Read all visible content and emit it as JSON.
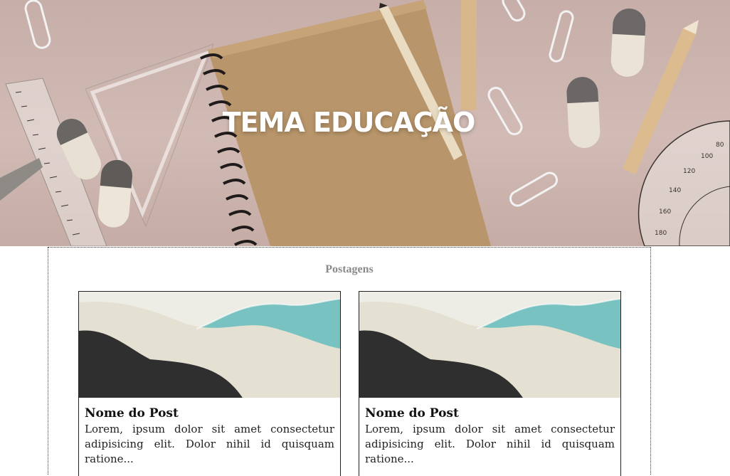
{
  "hero": {
    "title": "TEMA EDUCAÇÃO",
    "image": "school-supplies-background"
  },
  "posts_section": {
    "title": "Postagens",
    "cards": [
      {
        "title": "Nome do Post",
        "text": "Lorem, ipsum dolor sit amet consectetur adipisicing elit. Dolor nihil id quisquam ratione...",
        "image": "abstract-waves-thumbnail"
      },
      {
        "title": "Nome do Post",
        "text": "Lorem, ipsum dolor sit amet consectetur adipisicing elit. Dolor nihil id quisquam ratione...",
        "image": "abstract-waves-thumbnail"
      }
    ]
  },
  "colors": {
    "hero_bg": "#cdb5af",
    "notebook": "#b99466",
    "wave_dark": "#2f2f2f",
    "wave_teal": "#79c2c2",
    "wave_cream": "#e7e4d6"
  }
}
